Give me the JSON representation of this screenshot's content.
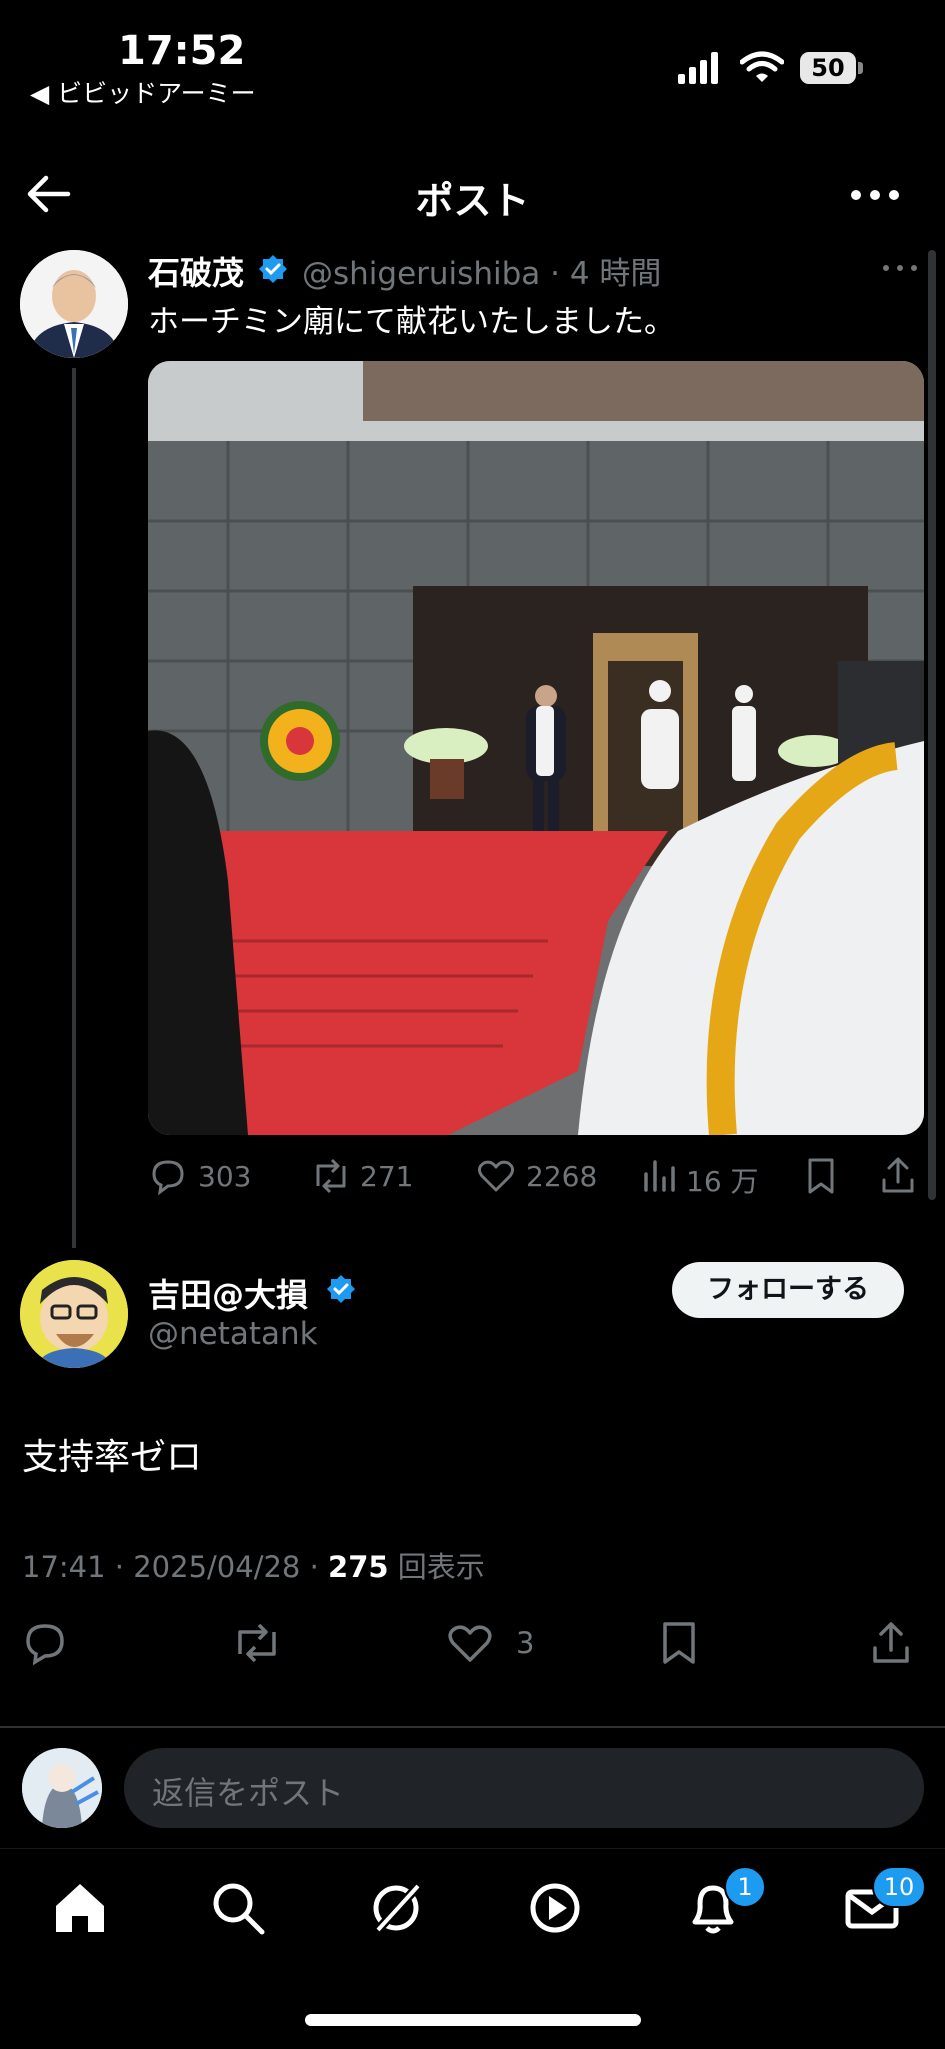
{
  "status_bar": {
    "time": "17:52",
    "back_app": "◀ ビビッドアーミー",
    "battery": "50"
  },
  "header": {
    "title": "ポスト"
  },
  "quoted_post": {
    "author_name": "石破茂",
    "handle_time": "@shigeruishiba · 4 時間",
    "text": "ホーチミン廟にて献花いたしました。",
    "actions": {
      "replies": "303",
      "reposts": "271",
      "likes": "2268",
      "views": "16 万"
    }
  },
  "main_post": {
    "author_name": "吉田@大損",
    "handle": "@netatank",
    "follow_label": "フォローする",
    "text": "支持率ゼロ",
    "meta_prefix": "17:41 · 2025/04/28 · ",
    "views_count": "275",
    "views_suffix": " 回表示",
    "like_count": "3"
  },
  "reply_bar": {
    "placeholder": "返信をポスト"
  },
  "tab_bar": {
    "notifications_badge": "1",
    "messages_badge": "10"
  },
  "colors": {
    "background": "#000000",
    "accent": "#1d9bf0",
    "muted": "#71767b",
    "red_carpet": "#d8363b"
  }
}
